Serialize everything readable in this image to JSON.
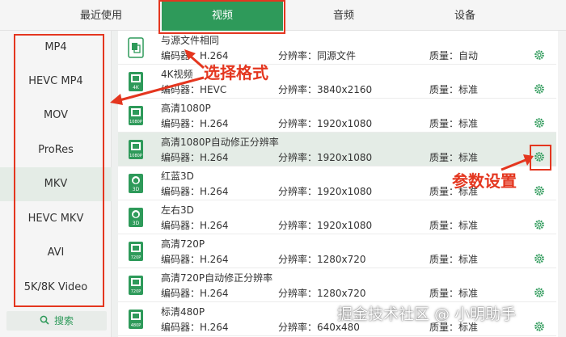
{
  "tabs": [
    {
      "label": "最近使用"
    },
    {
      "label": "视频"
    },
    {
      "label": "音频"
    },
    {
      "label": "设备"
    }
  ],
  "sidebar": {
    "items": [
      {
        "label": "MP4"
      },
      {
        "label": "HEVC MP4"
      },
      {
        "label": "MOV"
      },
      {
        "label": "ProRes"
      },
      {
        "label": "MKV"
      },
      {
        "label": "HEVC MKV"
      },
      {
        "label": "AVI"
      },
      {
        "label": "5K/8K Video"
      }
    ],
    "search_label": "搜索"
  },
  "presets": [
    {
      "title": "与源文件相同",
      "encoder": "编码器：H.264",
      "resolution": "分辨率：同源文件",
      "quality": "质量：自动",
      "badge": ""
    },
    {
      "title": "4K视频",
      "encoder": "编码器：HEVC",
      "resolution": "分辨率：3840x2160",
      "quality": "质量：标准",
      "badge": "4K"
    },
    {
      "title": "高清1080P",
      "encoder": "编码器：H.264",
      "resolution": "分辨率：1920x1080",
      "quality": "质量：标准",
      "badge": "1080P"
    },
    {
      "title": "高清1080P自动修正分辨率",
      "encoder": "编码器：H.264",
      "resolution": "分辨率：1920x1080",
      "quality": "质量：标准",
      "badge": "1080P"
    },
    {
      "title": "红蓝3D",
      "encoder": "编码器：H.264",
      "resolution": "分辨率：1920x1080",
      "quality": "质量：标准",
      "badge": "3D"
    },
    {
      "title": "左右3D",
      "encoder": "编码器：H.264",
      "resolution": "分辨率：1920x1080",
      "quality": "质量：标准",
      "badge": "3D"
    },
    {
      "title": "高清720P",
      "encoder": "编码器：H.264",
      "resolution": "分辨率：1280x720",
      "quality": "质量：标准",
      "badge": "720P"
    },
    {
      "title": "高清720P自动修正分辨率",
      "encoder": "编码器：H.264",
      "resolution": "分辨率：1280x720",
      "quality": "质量：标准",
      "badge": "720P"
    },
    {
      "title": "标清480P",
      "encoder": "编码器：H.264",
      "resolution": "分辨率：640x480",
      "quality": "质量：标准",
      "badge": "480P"
    }
  ],
  "annotations": {
    "select_format": "选择格式",
    "parameter_settings": "参数设置"
  },
  "watermark": "掘金技术社区 @ 小明助手",
  "colors": {
    "accent": "#2e9a5a",
    "annotation": "#e4361f",
    "selected_bg": "#e4ece6"
  }
}
